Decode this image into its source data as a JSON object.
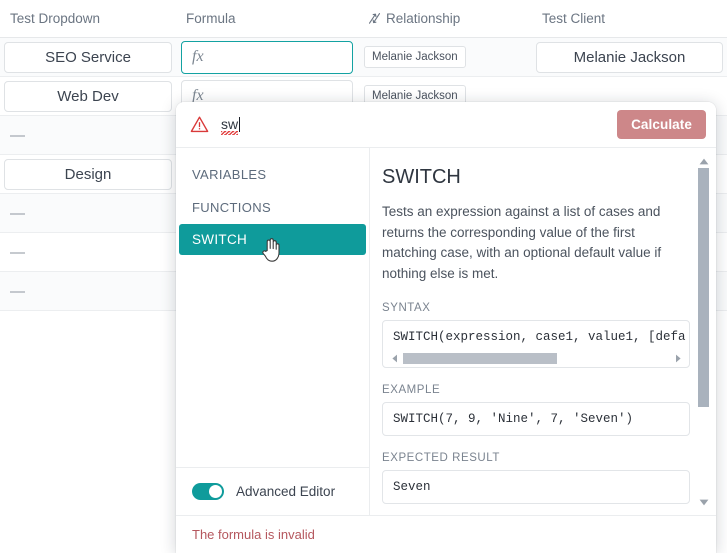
{
  "grid": {
    "columns": [
      {
        "label": "Test Dropdown",
        "icon": null
      },
      {
        "label": "Formula",
        "icon": null
      },
      {
        "label": "Relationship",
        "icon": "relationship-arrow-icon"
      },
      {
        "label": "Test Client",
        "icon": null
      }
    ],
    "rows": [
      {
        "dropdown": "SEO Service",
        "formula": "",
        "formula_icon": "fx-icon",
        "relationship": "Melanie Jackson",
        "client": "Melanie Jackson",
        "active": true
      },
      {
        "dropdown": "Web Dev",
        "formula": "",
        "formula_icon": "fx-icon",
        "relationship": "Melanie Jackson",
        "client": "",
        "active": false
      },
      {
        "dropdown": "—",
        "formula": "",
        "formula_icon": null,
        "relationship": "",
        "client": "",
        "active": false
      },
      {
        "dropdown": "Design",
        "formula": "",
        "formula_icon": null,
        "relationship": "",
        "client": "",
        "active": false
      },
      {
        "dropdown": "—",
        "formula": "",
        "formula_icon": null,
        "relationship": "",
        "client": "",
        "active": false
      },
      {
        "dropdown": "—",
        "formula": "",
        "formula_icon": null,
        "relationship": "",
        "client": "",
        "active": false
      },
      {
        "dropdown": "—",
        "formula": "",
        "formula_icon": null,
        "relationship": "",
        "client": "",
        "active": false
      }
    ]
  },
  "dialog": {
    "warning_icon": "warning-triangle-icon",
    "formula_value": "sw",
    "calculate_label": "Calculate",
    "nav": {
      "groups": [
        {
          "label": "VARIABLES"
        },
        {
          "label": "FUNCTIONS"
        }
      ],
      "selected_item": "SWITCH",
      "cursor_icon": "hand-pointer-cursor"
    },
    "advanced_editor_label": "Advanced Editor",
    "advanced_editor_on": true,
    "detail": {
      "title": "SWITCH",
      "description": "Tests an expression against a list of cases and returns the corresponding value of the first matching case, with an optional default value if nothing else is met.",
      "syntax_label": "SYNTAX",
      "syntax": "SWITCH(expression, case1, value1, [defa",
      "example_label": "EXAMPLE",
      "example": "SWITCH(7, 9, 'Nine', 7, 'Seven')",
      "expected_label": "EXPECTED RESULT",
      "expected": "Seven"
    },
    "error_message": "The formula is invalid"
  },
  "colors": {
    "accent_teal": "#0f9b9b",
    "calculate_bg": "#cd8789",
    "error_text": "#b5575e",
    "warning_red": "#d93a3a"
  }
}
